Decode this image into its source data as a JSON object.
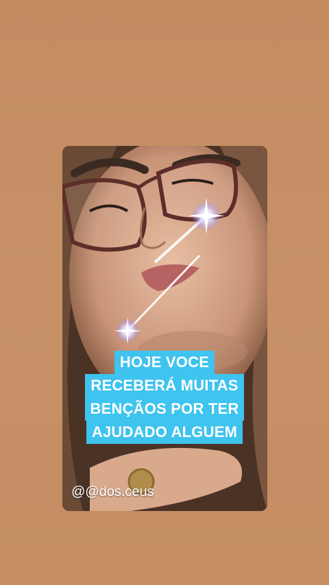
{
  "story": {
    "background_color": "#c58e63",
    "caption_lines": [
      "HOJE VOCE",
      "RECEBERÁ MUITAS",
      "BENÇÃOS POR TER",
      "AJUDADO ALGUEM"
    ],
    "caption_bg": "#3fc3ef",
    "handle": "@@dos.ceus",
    "photo": {
      "subject": "selfie-woman-glasses",
      "effect": "sparkle-stars"
    }
  }
}
